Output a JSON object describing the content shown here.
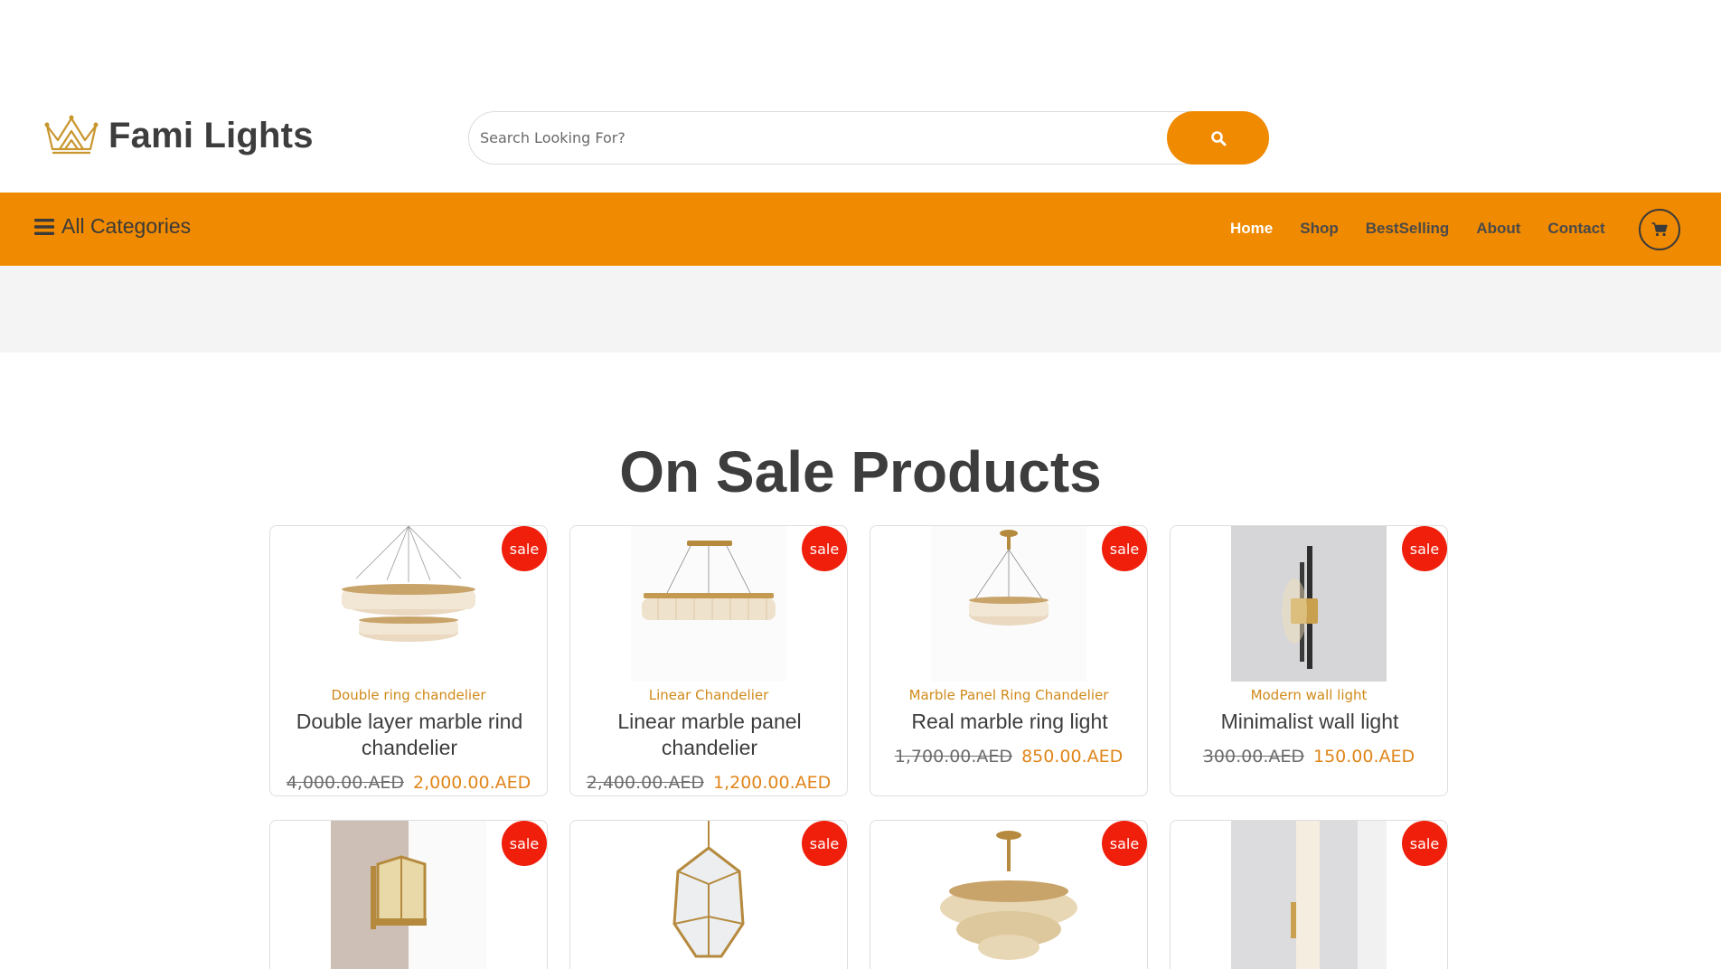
{
  "brand": {
    "name": "Fami Lights",
    "logo_icon": "crown-icon"
  },
  "search": {
    "placeholder": "Search Looking For?",
    "button_icon": "search-icon"
  },
  "nav": {
    "all_categories_label": "All Categories",
    "links": [
      {
        "label": "Home",
        "active": true
      },
      {
        "label": "Shop",
        "active": false
      },
      {
        "label": "BestSelling",
        "active": false
      },
      {
        "label": "About",
        "active": false
      },
      {
        "label": "Contact",
        "active": false
      }
    ],
    "cart_icon": "cart-icon"
  },
  "colors": {
    "accent": "#f08a00",
    "sale": "#ef1f0c",
    "category": "#d08a1a",
    "price": "#e0851a",
    "text": "#3d3d3d"
  },
  "section": {
    "title": "On Sale Products"
  },
  "products": [
    {
      "badge": "sale",
      "category": "Double ring chandelier",
      "name": "Double layer marble rind chandelier",
      "old_price": "4,000.00.AED",
      "new_price": "2,000.00.AED"
    },
    {
      "badge": "sale",
      "category": "Linear Chandelier",
      "name": "Linear marble panel chandelier",
      "old_price": "2,400.00.AED",
      "new_price": "1,200.00.AED"
    },
    {
      "badge": "sale",
      "category": "Marble Panel Ring Chandelier",
      "name": "Real marble ring light",
      "old_price": "1,700.00.AED",
      "new_price": "850.00.AED"
    },
    {
      "badge": "sale",
      "category": "Modern wall light",
      "name": "Minimalist wall light",
      "old_price": "300.00.AED",
      "new_price": "150.00.AED"
    },
    {
      "badge": "sale"
    },
    {
      "badge": "sale"
    },
    {
      "badge": "sale"
    },
    {
      "badge": "sale"
    }
  ]
}
